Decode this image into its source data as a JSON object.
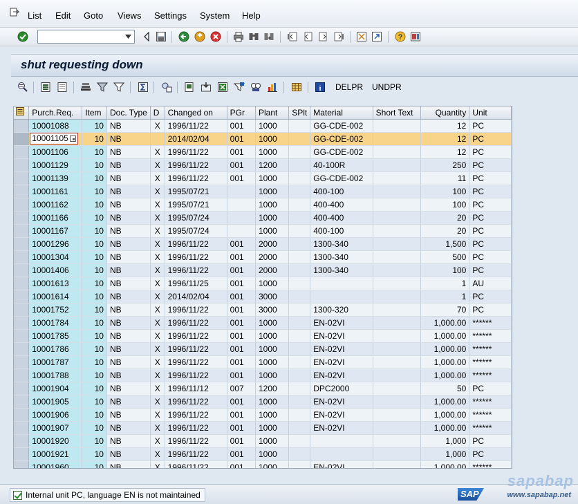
{
  "menu": {
    "items": [
      {
        "label": "List"
      },
      {
        "label": "Edit"
      },
      {
        "label": "Goto"
      },
      {
        "label": "Views"
      },
      {
        "label": "Settings"
      },
      {
        "label": "System"
      },
      {
        "label": "Help"
      }
    ]
  },
  "toolbar": {
    "command_value": "",
    "icons": [
      "enter-icon",
      "command-dropdown-icon",
      "collapse-icon",
      "save-icon",
      "back-icon",
      "exit-icon",
      "cancel-icon",
      "print-icon",
      "find-icon",
      "find-next-icon",
      "first-page-icon",
      "previous-page-icon",
      "next-page-icon",
      "last-page-icon",
      "new-session-icon",
      "shortcut-icon",
      "help-icon",
      "layout-icon"
    ]
  },
  "header": {
    "title": "shut requesting down"
  },
  "app_toolbar": {
    "icons": [
      "details-icon",
      "select-all-icon",
      "deselect-all-icon",
      "sort-ascending-icon",
      "filter-icon",
      "set-filter-icon",
      "total-icon",
      "subtotal-icon",
      "print-preview-icon",
      "export-icon",
      "spreadsheet-icon",
      "word-processing-icon",
      "local-file-icon",
      "graphic-icon",
      "layout-grid-icon",
      "info-icon"
    ],
    "buttons": [
      "DELPR",
      "UNDPR"
    ]
  },
  "grid": {
    "columns": [
      "Purch.Req.",
      "Item",
      "Doc. Type",
      "D",
      "Changed on",
      "PGr",
      "Plant",
      "SPlt",
      "Material",
      "Short Text",
      "Quantity",
      "Unit"
    ],
    "highlighted_row": 1,
    "rows": [
      [
        "10001088",
        "10",
        "NB",
        "X",
        "1996/11/22",
        "001",
        "1000",
        "",
        "GG-CDE-002",
        "",
        "12",
        "PC"
      ],
      [
        "10001105",
        "10",
        "NB",
        "",
        "2014/02/04",
        "001",
        "1000",
        "",
        "GG-CDE-002",
        "",
        "12",
        "PC"
      ],
      [
        "10001106",
        "10",
        "NB",
        "X",
        "1996/11/22",
        "001",
        "1000",
        "",
        "GG-CDE-002",
        "",
        "12",
        "PC"
      ],
      [
        "10001129",
        "10",
        "NB",
        "X",
        "1996/11/22",
        "001",
        "1200",
        "",
        "40-100R",
        "",
        "250",
        "PC"
      ],
      [
        "10001139",
        "10",
        "NB",
        "X",
        "1996/11/22",
        "001",
        "1000",
        "",
        "GG-CDE-002",
        "",
        "11",
        "PC"
      ],
      [
        "10001161",
        "10",
        "NB",
        "X",
        "1995/07/21",
        "",
        "1000",
        "",
        "400-100",
        "",
        "100",
        "PC"
      ],
      [
        "10001162",
        "10",
        "NB",
        "X",
        "1995/07/21",
        "",
        "1000",
        "",
        "400-400",
        "",
        "100",
        "PC"
      ],
      [
        "10001166",
        "10",
        "NB",
        "X",
        "1995/07/24",
        "",
        "1000",
        "",
        "400-400",
        "",
        "20",
        "PC"
      ],
      [
        "10001167",
        "10",
        "NB",
        "X",
        "1995/07/24",
        "",
        "1000",
        "",
        "400-100",
        "",
        "20",
        "PC"
      ],
      [
        "10001296",
        "10",
        "NB",
        "X",
        "1996/11/22",
        "001",
        "2000",
        "",
        "1300-340",
        "",
        "1,500",
        "PC"
      ],
      [
        "10001304",
        "10",
        "NB",
        "X",
        "1996/11/22",
        "001",
        "2000",
        "",
        "1300-340",
        "",
        "500",
        "PC"
      ],
      [
        "10001406",
        "10",
        "NB",
        "X",
        "1996/11/22",
        "001",
        "2000",
        "",
        "1300-340",
        "",
        "100",
        "PC"
      ],
      [
        "10001613",
        "10",
        "NB",
        "X",
        "1996/11/25",
        "001",
        "1000",
        "",
        "",
        "",
        "1",
        "AU"
      ],
      [
        "10001614",
        "10",
        "NB",
        "X",
        "2014/02/04",
        "001",
        "3000",
        "",
        "",
        "",
        "1",
        "PC"
      ],
      [
        "10001752",
        "10",
        "NB",
        "X",
        "1996/11/22",
        "001",
        "3000",
        "",
        "1300-320",
        "",
        "70",
        "PC"
      ],
      [
        "10001784",
        "10",
        "NB",
        "X",
        "1996/11/22",
        "001",
        "1000",
        "",
        "EN-02VI",
        "",
        "1,000.00",
        "******"
      ],
      [
        "10001785",
        "10",
        "NB",
        "X",
        "1996/11/22",
        "001",
        "1000",
        "",
        "EN-02VI",
        "",
        "1,000.00",
        "******"
      ],
      [
        "10001786",
        "10",
        "NB",
        "X",
        "1996/11/22",
        "001",
        "1000",
        "",
        "EN-02VI",
        "",
        "1,000.00",
        "******"
      ],
      [
        "10001787",
        "10",
        "NB",
        "X",
        "1996/11/22",
        "001",
        "1000",
        "",
        "EN-02VI",
        "",
        "1,000.00",
        "******"
      ],
      [
        "10001788",
        "10",
        "NB",
        "X",
        "1996/11/22",
        "001",
        "1000",
        "",
        "EN-02VI",
        "",
        "1,000.00",
        "******"
      ],
      [
        "10001904",
        "10",
        "NB",
        "X",
        "1996/11/12",
        "007",
        "1200",
        "",
        "DPC2000",
        "",
        "50",
        "PC"
      ],
      [
        "10001905",
        "10",
        "NB",
        "X",
        "1996/11/22",
        "001",
        "1000",
        "",
        "EN-02VI",
        "",
        "1,000.00",
        "******"
      ],
      [
        "10001906",
        "10",
        "NB",
        "X",
        "1996/11/22",
        "001",
        "1000",
        "",
        "EN-02VI",
        "",
        "1,000.00",
        "******"
      ],
      [
        "10001907",
        "10",
        "NB",
        "X",
        "1996/11/22",
        "001",
        "1000",
        "",
        "EN-02VI",
        "",
        "1,000.00",
        "******"
      ],
      [
        "10001920",
        "10",
        "NB",
        "X",
        "1996/11/22",
        "001",
        "1000",
        "",
        "",
        "",
        "1,000",
        "PC"
      ],
      [
        "10001921",
        "10",
        "NB",
        "X",
        "1996/11/22",
        "001",
        "1000",
        "",
        "",
        "",
        "1,000",
        "PC"
      ],
      [
        "10001960",
        "10",
        "NB",
        "X",
        "1996/11/22",
        "001",
        "1000",
        "",
        "EN-02VI",
        "",
        "1,000.00",
        "******"
      ]
    ]
  },
  "status": {
    "type": "success",
    "message": "Internal unit PC, language EN is not maintained"
  },
  "branding": {
    "sap_logo": "SAP",
    "watermark_top": "sapabap",
    "watermark_url": "www.sapabap.net"
  },
  "colors": {
    "highlight_row": "#f8d48b",
    "key_column": "#bfe8f0",
    "row_even": "#eef3f8",
    "row_odd": "#dfe8f2",
    "background": "#dfe7f1"
  }
}
